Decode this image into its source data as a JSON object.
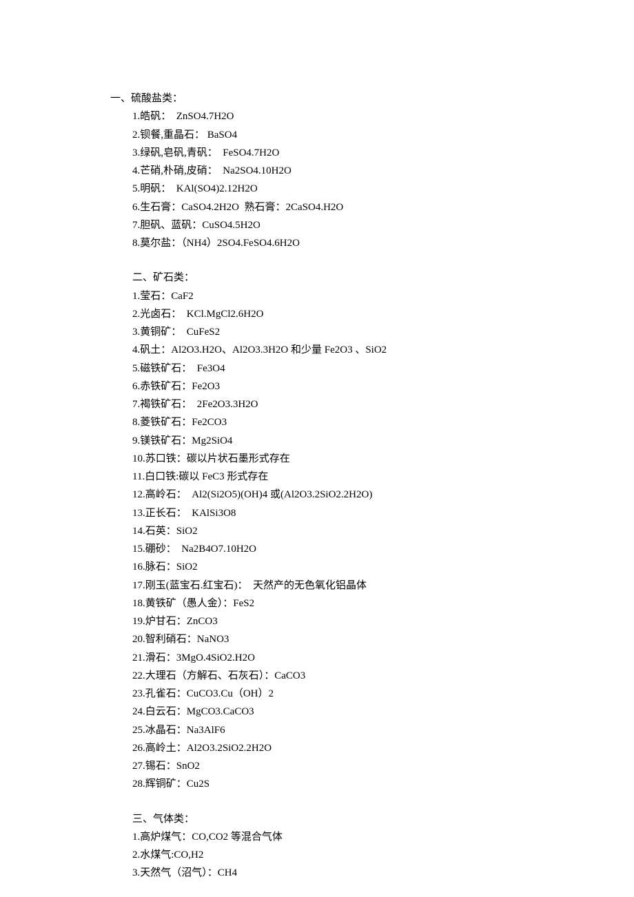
{
  "sections": [
    {
      "title": "一、硫酸盐类：",
      "items": [
        "1.皓矾：  ZnSO4.7H2O",
        "2.钡餐,重晶石： BaSO4",
        "3.绿矾,皂矾,青矾：  FeSO4.7H2O",
        "4.芒硝,朴硝,皮硝：  Na2SO4.10H2O",
        "5.明矾：  KAl(SO4)2.12H2O",
        "6.生石膏：CaSO4.2H2O  熟石膏：2CaSO4.H2O",
        "7.胆矾、蓝矾：CuSO4.5H2O",
        "8.莫尔盐：（NH4）2SO4.FeSO4.6H2O"
      ]
    },
    {
      "title": "二、矿石类：",
      "items": [
        "1.莹石：CaF2",
        "2.光卤石：  KCl.MgCl2.6H2O",
        "3.黄铜矿：  CuFeS2",
        "4.矾土：Al2O3.H2O、Al2O3.3H2O 和少量 Fe2O3 、SiO2",
        "5.磁铁矿石：  Fe3O4",
        "6.赤铁矿石：Fe2O3",
        "7.褐铁矿石：  2Fe2O3.3H2O",
        "8.菱铁矿石：Fe2CO3",
        "9.镁铁矿石：Mg2SiO4",
        "10.苏口铁：碳以片状石墨形式存在",
        "11.白口铁:碳以 FeC3 形式存在",
        "12.高岭石：  Al2(Si2O5)(OH)4 或(Al2O3.2SiO2.2H2O)",
        "13.正长石：  KAlSi3O8",
        "14.石英：SiO2",
        "15.硼砂：  Na2B4O7.10H2O",
        "16.脉石：SiO2",
        "17.刚玉(蓝宝石.红宝石)：  天然产的无色氧化铝晶体",
        "18.黄铁矿（愚人金）：FeS2",
        "19.炉甘石：ZnCO3",
        "20.智利硝石：NaNO3",
        "21.滑石：3MgO.4SiO2.H2O",
        "22.大理石（方解石、石灰石）：CaCO3",
        "23.孔雀石：CuCO3.Cu（OH）2",
        "24.白云石：MgCO3.CaCO3",
        "25.冰晶石：Na3AlF6",
        "26.高岭土：Al2O3.2SiO2.2H2O",
        "27.锡石：SnO2",
        "28.辉铜矿：Cu2S"
      ]
    },
    {
      "title": "三、气体类：",
      "items": [
        "1.高炉煤气：CO,CO2 等混合气体",
        "2.水煤气:CO,H2",
        "3.天然气（沼气）：CH4"
      ]
    }
  ]
}
